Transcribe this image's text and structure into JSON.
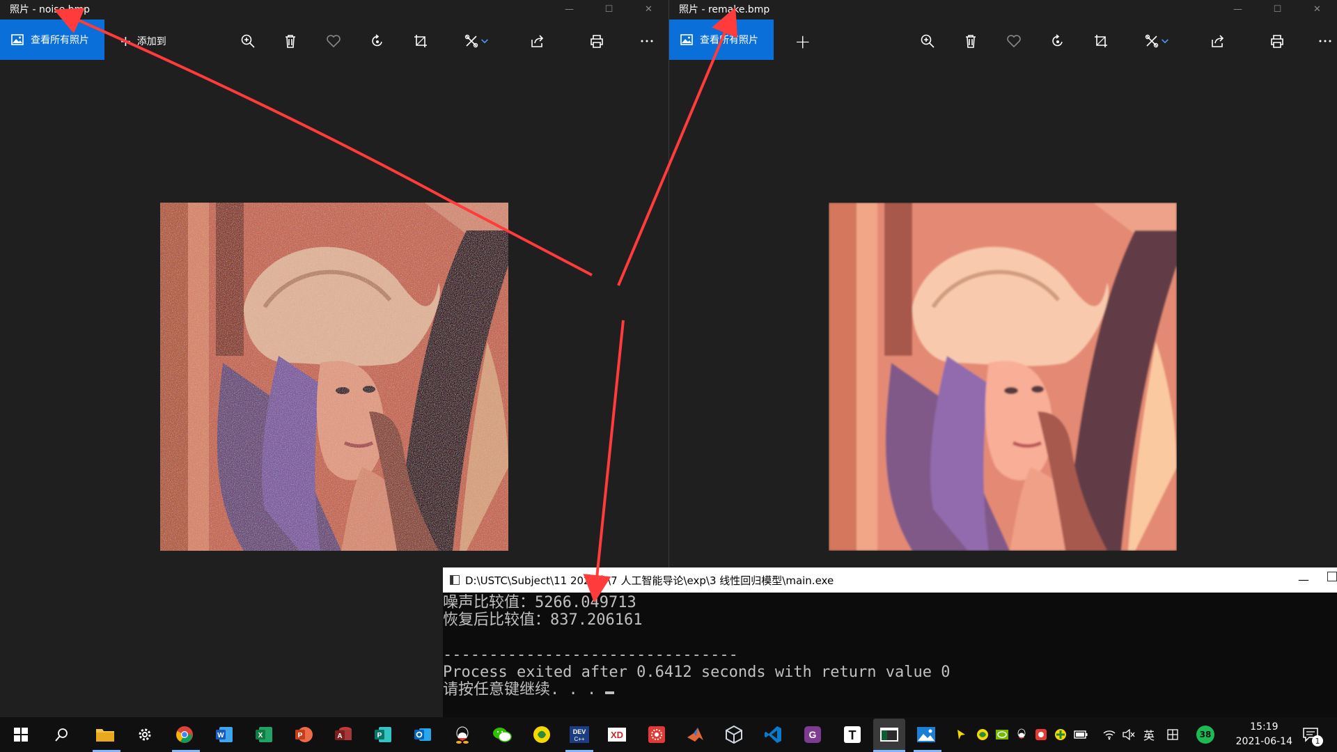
{
  "left_window": {
    "title": "照片 - noise.bmp",
    "view_all_label": "查看所有照片",
    "add_label": "添加到"
  },
  "right_window": {
    "title": "照片 - remake.bmp",
    "view_all_label": "查看所有照片"
  },
  "toolbar_icons": [
    "zoom-icon",
    "delete-icon",
    "favorite-icon",
    "rotate-icon",
    "crop-icon",
    "edit-icon",
    "share-icon",
    "print-icon",
    "more-icon"
  ],
  "console": {
    "title": "D:\\USTC\\Subject\\11 2021春\\7 人工智能导论\\exp\\3 线性回归模型\\main.exe",
    "lines": [
      "噪声比较值：5266.049713",
      "恢复后比较值：837.206161",
      "",
      "--------------------------------",
      "Process exited after 0.6412 seconds with return value 0",
      "请按任意键继续. . . "
    ]
  },
  "taskbar": {
    "time": "15:19",
    "date": "2021-06-14",
    "ime_label": "英",
    "notification_count": "1",
    "badge_count": "38"
  },
  "colors": {
    "accent": "#0a6fd8",
    "arrow": "#ff3b3b"
  }
}
